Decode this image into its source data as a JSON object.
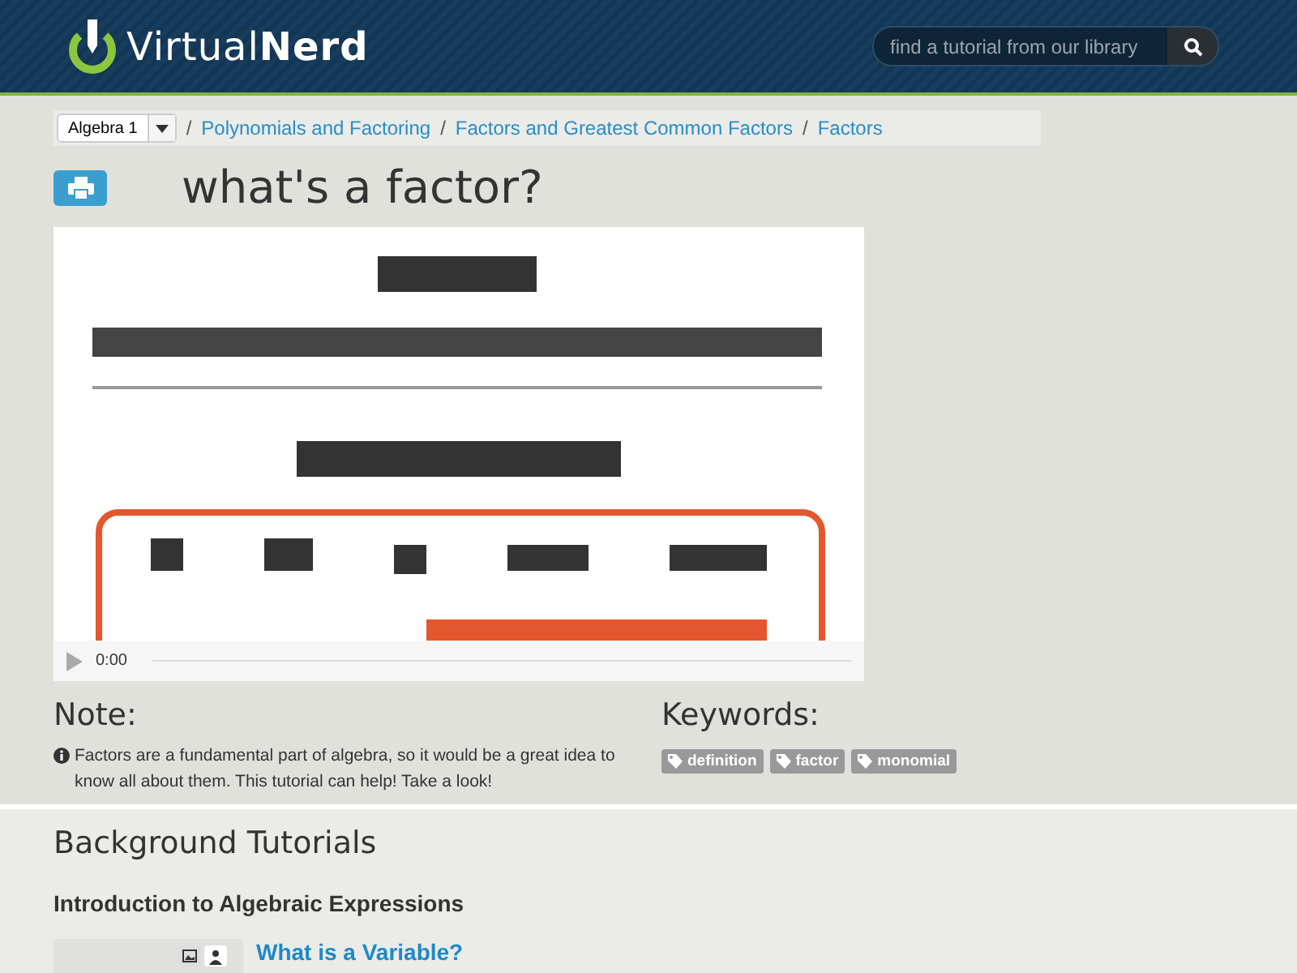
{
  "header": {
    "logo": "Virtual**Nerd**",
    "search": {
      "placeholder": "find a tutorial from our library"
    }
  },
  "breadcrumb": {
    "subject": "Algebra 1",
    "separator": "/",
    "links": [
      "Polynomials and Factoring",
      "Factors and Greatest Common Factors",
      "Factors"
    ]
  },
  "title": "what's a factor?",
  "video": {
    "kind": "picture",
    "time": "0:00"
  },
  "note": {
    "heading": "Note:",
    "text": "Factors are a fundamental part of algebra, so it would be a great idea to know all about them. This tutorial can help! Take a look!"
  },
  "keywords": {
    "heading": "Keywords:",
    "tags": [
      "definition",
      "factor",
      "monomial"
    ]
  },
  "background": {
    "heading": "Background Tutorials",
    "sections": [
      {
        "title": "Introduction to Algebraic Expressions",
        "tutorials": [
          "What is a Variable?"
        ]
      }
    ]
  }
}
